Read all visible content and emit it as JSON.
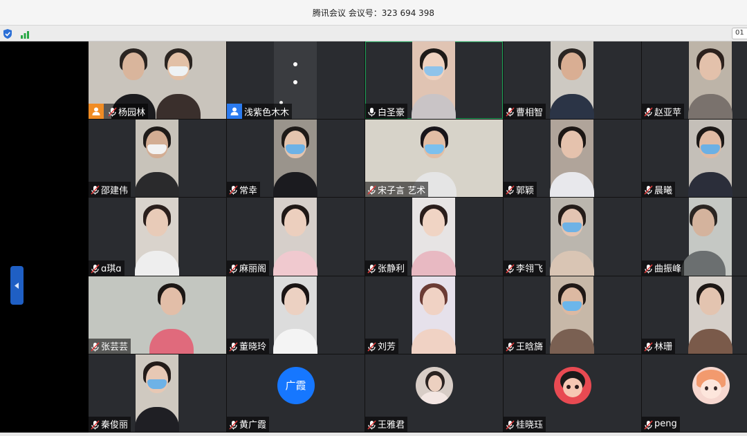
{
  "window": {
    "title": "腾讯会议 会议号：323 694 398"
  },
  "toolbar": {
    "timer_text": "01",
    "icons": [
      "shield-icon",
      "signal-icon"
    ]
  },
  "colors": {
    "accent": "#1f5fc4",
    "active_border": "#1fa85a",
    "host_badge": "#f08c24",
    "cohost_badge": "#2b7bf0",
    "avatar_bg": "#1677ff"
  },
  "participants": [
    {
      "name": "杨园林",
      "badge": "host"
    },
    {
      "name": "浅紫色木木",
      "badge": "cohost"
    },
    {
      "name": "白圣豪",
      "mic": "on",
      "active": true
    },
    {
      "name": "曹相智"
    },
    {
      "name": "赵亚苹"
    },
    {
      "name": "邵建伟"
    },
    {
      "name": "常幸"
    },
    {
      "name": "宋子言 艺术"
    },
    {
      "name": "郭颖"
    },
    {
      "name": "晨曦"
    },
    {
      "name": "ɑ琪ɑ"
    },
    {
      "name": "麻丽阁"
    },
    {
      "name": "张静利"
    },
    {
      "name": "李翎飞"
    },
    {
      "name": "曲振峰"
    },
    {
      "name": "张芸芸"
    },
    {
      "name": "董晓玲"
    },
    {
      "name": "刘芳"
    },
    {
      "name": "王晗旖"
    },
    {
      "name": "林珊"
    },
    {
      "name": "秦俊丽"
    },
    {
      "name": "黄广霞",
      "avatar_text": "广霞"
    },
    {
      "name": "王雅君",
      "avatar": "photo"
    },
    {
      "name": "桂晓珏",
      "avatar": "cartoon"
    },
    {
      "name": "peng",
      "avatar": "anime"
    }
  ]
}
